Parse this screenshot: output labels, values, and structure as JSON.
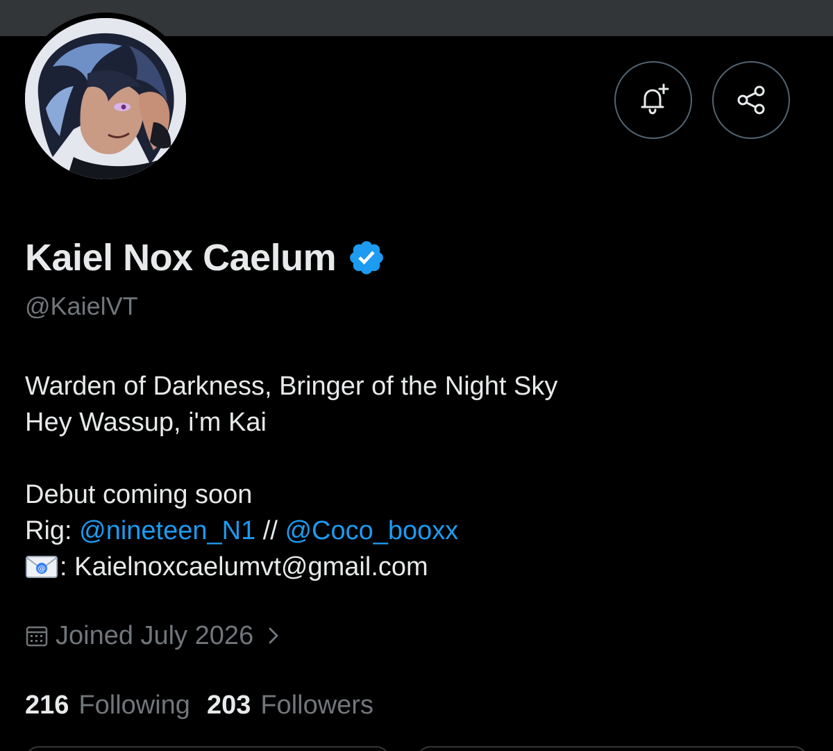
{
  "profile": {
    "display_name": "Kaiel Nox Caelum",
    "handle": "@KaielVT",
    "verified_icon": "verified-badge-icon",
    "avatar_description_icon": "avatar"
  },
  "actions": {
    "notify_icon": "bell-plus-icon",
    "share_icon": "share-icon"
  },
  "bio": {
    "line1": "Warden of Darkness, Bringer of the Night Sky",
    "line2": "Hey Wassup, i'm Kai",
    "line3": "Debut coming soon",
    "rig_prefix": "Rig: ",
    "rig_mention1": "@nineteen_N1",
    "rig_separator": " // ",
    "rig_mention2": "@Coco_booxx",
    "email_emoji_icon": "envelope-email-icon",
    "email_text": ": Kaielnoxcaelumvt@gmail.com"
  },
  "joined": {
    "icon": "calendar-icon",
    "text": "Joined July 2026",
    "chevron_icon": "chevron-right-icon"
  },
  "stats": {
    "following_count": "216",
    "following_label": "Following",
    "followers_count": "203",
    "followers_label": "Followers"
  },
  "colors": {
    "background": "#000000",
    "banner": "#333639",
    "text_primary": "#e7e9ea",
    "text_secondary": "#71767b",
    "accent": "#1d9bf0"
  }
}
